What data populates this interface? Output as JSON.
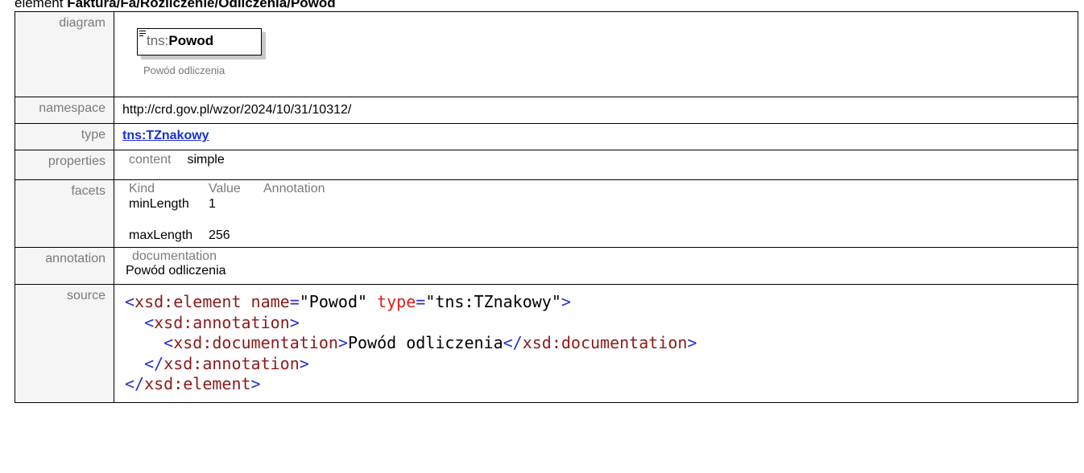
{
  "heading": {
    "prefix": "element",
    "path": "Faktura/Fa/Rozliczenie/Odliczenia/Powod"
  },
  "rows": {
    "diagram": {
      "label": "diagram",
      "box_prefix": "tns:",
      "box_name": "Powod",
      "box_doc": "Powód odliczenia"
    },
    "namespace": {
      "label": "namespace",
      "value": "http://crd.gov.pl/wzor/2024/10/31/10312/"
    },
    "type": {
      "label": "type",
      "value": "tns:TZnakowy"
    },
    "properties": {
      "label": "properties",
      "key": "content",
      "value": "simple"
    },
    "facets": {
      "label": "facets",
      "headers": [
        "Kind",
        "Value",
        "Annotation"
      ],
      "items": [
        {
          "kind": "minLength",
          "value": "1"
        },
        {
          "kind": "maxLength",
          "value": "256"
        }
      ]
    },
    "annotation": {
      "label": "annotation",
      "key": "documentation",
      "value": "Powód odliczenia"
    },
    "source": {
      "label": "source",
      "lines": [
        "<xsd:element name=\"Powod\" type=\"tns:TZnakowy\">",
        "  <xsd:annotation>",
        "    <xsd:documentation>Powód odliczenia</xsd:documentation>",
        "  </xsd:annotation>",
        "</xsd:element>"
      ]
    }
  },
  "colors": {
    "link": "#1a2fd6",
    "label_bg": "#f5f5f5",
    "label_text": "#7a7a7a",
    "xml_tag": "#8b1a1a",
    "xml_attr": "#e01b1b",
    "xml_punct": "#2430d0"
  }
}
